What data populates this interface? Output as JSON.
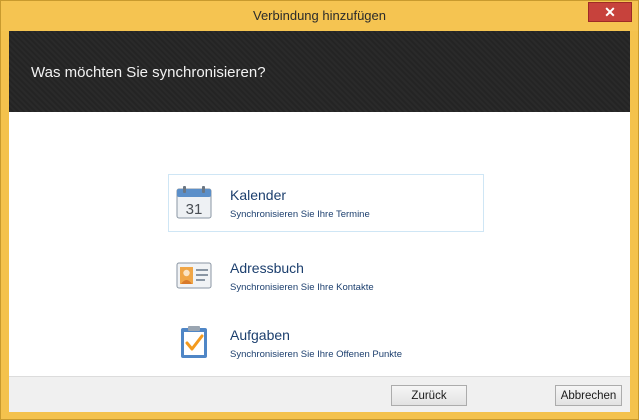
{
  "window": {
    "title": "Verbindung hinzufügen",
    "close_glyph": "✕"
  },
  "header": {
    "prompt": "Was möchten Sie synchronisieren?"
  },
  "options": [
    {
      "title": "Kalender",
      "subtitle": "Synchronisieren Sie Ihre Termine",
      "icon": "calendar-icon",
      "icon_text": "31",
      "selected": true
    },
    {
      "title": "Adressbuch",
      "subtitle": "Synchronisieren Sie Ihre Kontakte",
      "icon": "address-book-icon",
      "selected": false
    },
    {
      "title": "Aufgaben",
      "subtitle": "Synchronisieren Sie Ihre Offenen Punkte",
      "icon": "tasks-icon",
      "selected": false
    }
  ],
  "footer": {
    "back_label": "Zurück",
    "cancel_label": "Abbrechen"
  },
  "colors": {
    "title_bar": "#f5c451",
    "close_button": "#c7423c",
    "header_bg": "#2a2a2a",
    "option_text": "#1c3f6e",
    "selection_border": "#cfe6f5"
  }
}
